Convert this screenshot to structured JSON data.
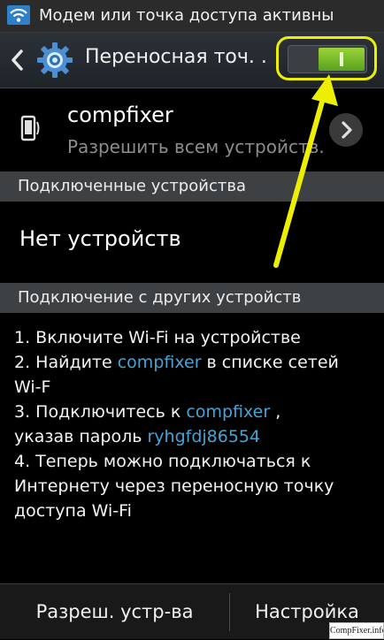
{
  "status_bar": {
    "text": "Модем или точка доступа активны",
    "icon": "wifi-icon"
  },
  "action_bar": {
    "title": "Переносная точ. .",
    "back_icon": "chevron-left-icon",
    "app_icon": "gear-icon",
    "toggle_state": "on",
    "highlight_color": "#ecf000"
  },
  "network": {
    "icon": "phone-icon",
    "name": "compfixer",
    "subtitle": "Разрешить всем устройств.",
    "chevron_icon": "chevron-right-icon"
  },
  "connected_section": {
    "header": "Подключенные устройства",
    "empty_text": "Нет устройств"
  },
  "other_section": {
    "header": "Подключение с других устройств"
  },
  "instructions": {
    "line1": "1. Включите Wi-Fi на устройстве",
    "line2_prefix": "2. Найдите ",
    "line2_link": "compfixer",
    "line2_suffix": " в списке сетей",
    "line3": "Wi-F",
    "line4_prefix": "3. Подключитесь к ",
    "line4_link": "compfixer",
    "line4_suffix": " ,",
    "line5_prefix": "указав пароль ",
    "line5_link": "ryhgfdj86554",
    "line6": "4. Теперь можно подключаться к",
    "line7": "Интернету через переносную точку",
    "line8": "доступа Wi-Fi"
  },
  "bottom_bar": {
    "left_label": "Разреш. устр-ва",
    "right_label": "Настройка"
  },
  "watermark": "CompFixer.info",
  "colors": {
    "link": "#47a3d6",
    "toggle_on": "#7cbf2a",
    "annotation": "#ecf000",
    "section_header": "#3d4144"
  }
}
